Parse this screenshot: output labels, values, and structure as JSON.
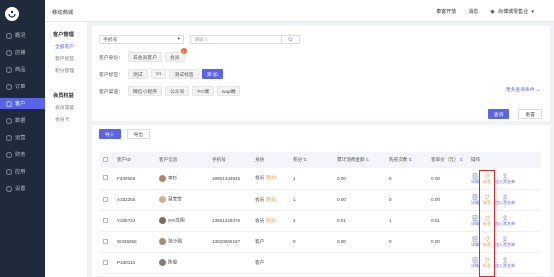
{
  "sidebar": {
    "items": [
      {
        "label": "概况",
        "active": false
      },
      {
        "label": "店铺",
        "active": false
      },
      {
        "label": "商品",
        "active": false
      },
      {
        "label": "订单",
        "active": false
      },
      {
        "label": "客户",
        "active": true
      },
      {
        "label": "数据",
        "active": false
      },
      {
        "label": "运营",
        "active": false
      },
      {
        "label": "财务",
        "active": false
      },
      {
        "label": "应用",
        "active": false
      },
      {
        "label": "设置",
        "active": false
      }
    ]
  },
  "topbar": {
    "title": "移动商城",
    "links": [
      "泰客开放",
      "消息"
    ],
    "user": "尚博城零售业"
  },
  "submenu": {
    "groups": [
      {
        "title": "客户管理",
        "items": [
          "全部客户",
          "客户标签",
          "积分管理"
        ]
      },
      {
        "title": "会员权益",
        "items": [
          "会员等级",
          "会员卡"
        ]
      }
    ]
  },
  "filters": {
    "field_select": "手机号",
    "search_placeholder": "请输入",
    "identity_label": "客户身份：",
    "identity_options": [
      "非会员客户",
      "会员"
    ],
    "identity_badge": "1",
    "tag_label": "客户标签：",
    "tag_options": [
      "测试",
      "V1",
      "测试标签",
      "添 加"
    ],
    "channel_label": "客户渠道：",
    "channel_options": [
      "微信小程序",
      "公众号",
      "PC端",
      "wap端"
    ],
    "more": "更多查询条件",
    "query_btn": "查询",
    "reset_btn": "重置"
  },
  "actions": {
    "import": "导入",
    "export": "导出"
  },
  "table": {
    "headers": [
      "客户ID",
      "客户信息",
      "手机号",
      "身份",
      "积分",
      "累计消费金额",
      "购买次数",
      "客单价（元）",
      "操作"
    ],
    "rows": [
      {
        "id": "F330528",
        "name": "李杉",
        "phone": "18801433945",
        "identity": "会员",
        "tag": "测试1",
        "points": "1",
        "spend": "0.00",
        "orders": "0",
        "aov": "0.00"
      },
      {
        "id": "A332255",
        "name": "莫莹莹",
        "phone": "",
        "identity": "会员",
        "tag": "测试1",
        "points": "1",
        "spend": "0.00",
        "orders": "0",
        "aov": "0.00"
      },
      {
        "id": "Y336722",
        "name": "yan左翔",
        "phone": "13661226476",
        "identity": "会员",
        "tag": "测试1",
        "points": "2",
        "spend": "0.01",
        "orders": "1",
        "aov": "0.01"
      },
      {
        "id": "W336256",
        "name": "张沙璐",
        "phone": "13520065167",
        "identity": "客户",
        "tag": "",
        "points": "0",
        "spend": "0.00",
        "orders": "0",
        "aov": "0.00"
      },
      {
        "id": "P330114",
        "name": "陈俊",
        "phone": "",
        "identity": "客户",
        "tag": "",
        "points": "",
        "spend": "",
        "orders": "",
        "aov": ""
      }
    ],
    "ops": {
      "detail": "详情",
      "tag": "标签",
      "blacklist": "加入黑名单"
    }
  },
  "colors": {
    "accent": "#5a64e8",
    "sidebar": "#1f2b3a",
    "tag": "#f0903a",
    "highlight": "#e0232c"
  }
}
